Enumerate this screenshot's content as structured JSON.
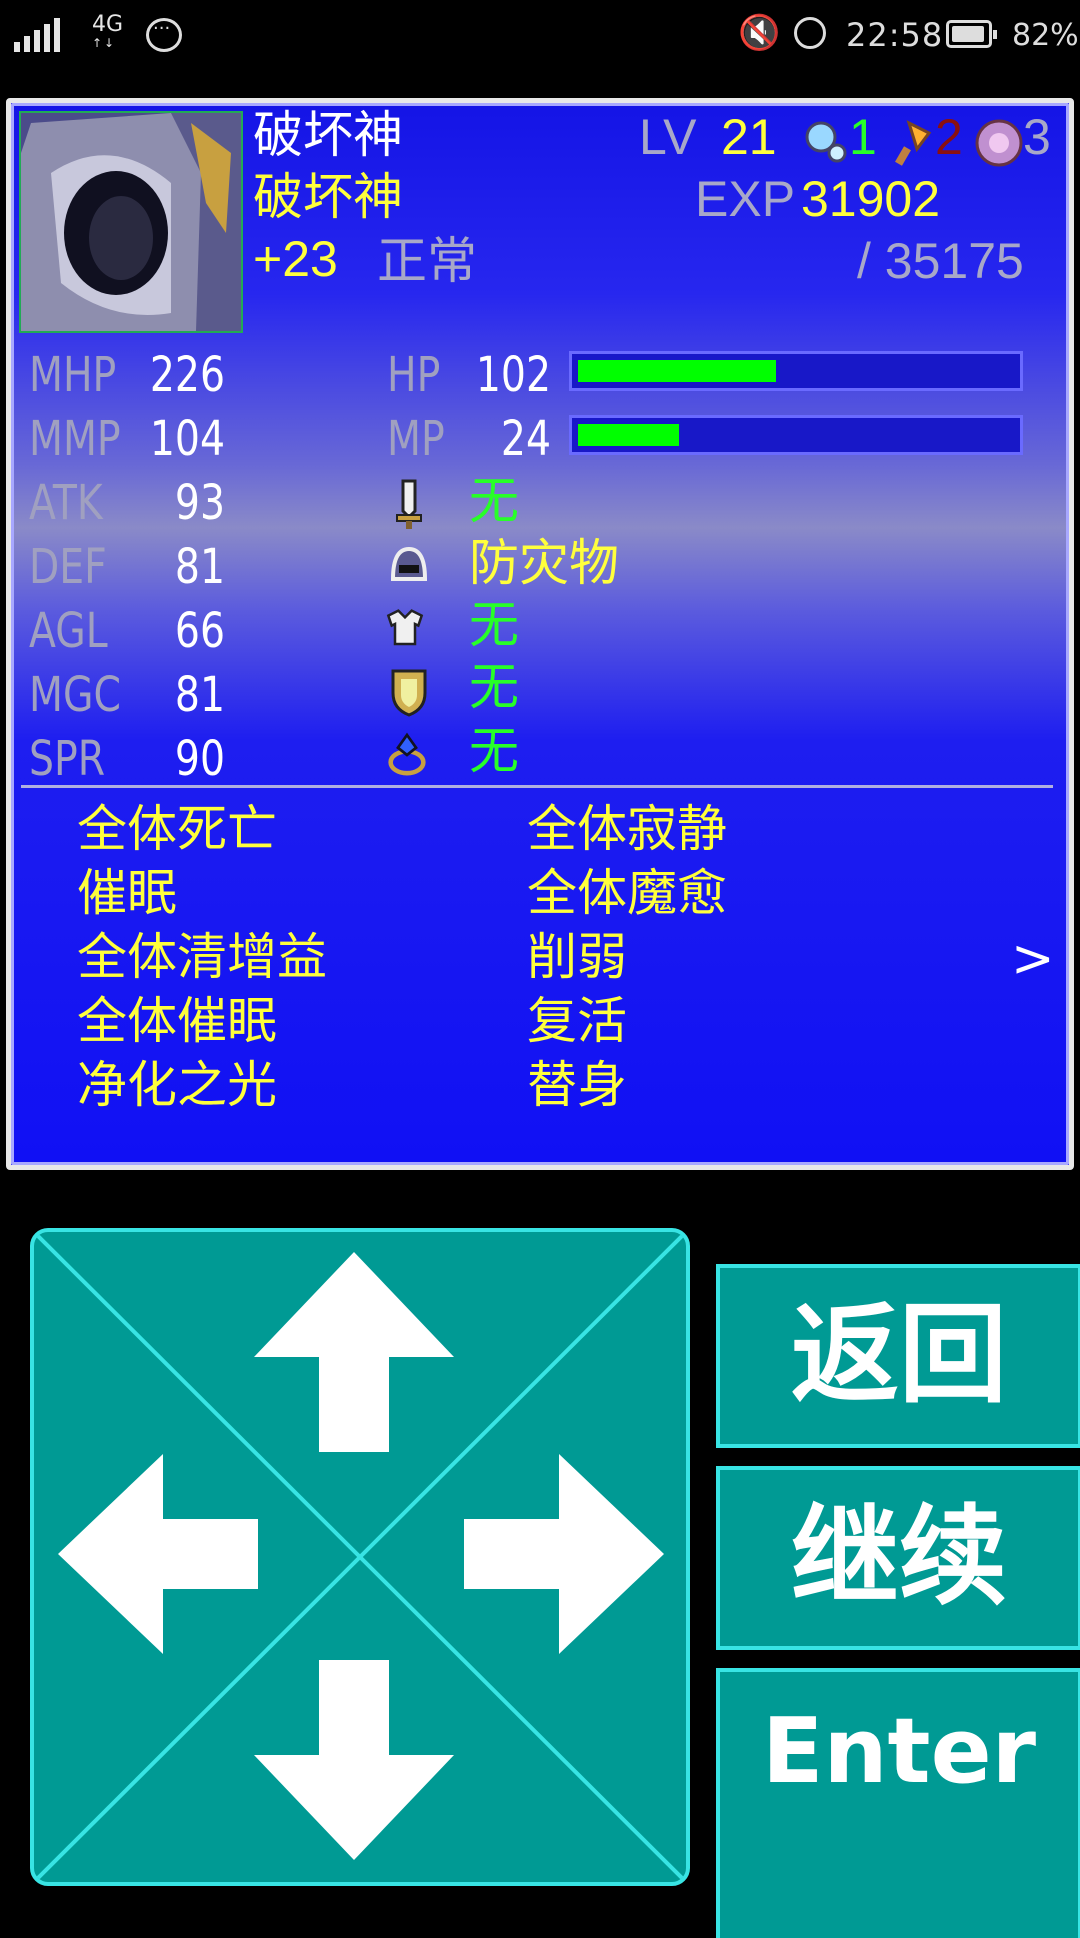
{
  "status_bar": {
    "network": "4G",
    "network_sub": "↑↓",
    "time": "22:58",
    "battery": "82%"
  },
  "character": {
    "name": "破坏神",
    "class": "破坏神",
    "plus": "+23",
    "condition": "正常",
    "lv_label": "LV",
    "level": "21",
    "exp_label": "EXP",
    "exp": "31902",
    "exp_next": "/ 35175",
    "items": [
      {
        "icon": "crystal-icon",
        "count": "1",
        "color": "#28ff28"
      },
      {
        "icon": "torch-icon",
        "count": "2",
        "color": "#8a1010"
      },
      {
        "icon": "orb-icon",
        "count": "3",
        "color": "#a8a8c8"
      }
    ]
  },
  "stats": [
    {
      "label": "MHP",
      "value": "226"
    },
    {
      "label": "MMP",
      "value": "104"
    },
    {
      "label": "ATK",
      "value": "93"
    },
    {
      "label": "DEF",
      "value": "81"
    },
    {
      "label": "AGL",
      "value": "66"
    },
    {
      "label": "MGC",
      "value": "81"
    },
    {
      "label": "SPR",
      "value": "90"
    }
  ],
  "gauges": {
    "hp_label": "HP",
    "hp": "102",
    "hp_ratio": 0.45,
    "mp_label": "MP",
    "mp": "24",
    "mp_ratio": 0.23
  },
  "equipment": [
    {
      "icon": "sword-icon",
      "name": "无"
    },
    {
      "icon": "helmet-icon",
      "name": "防灾物"
    },
    {
      "icon": "armor-icon",
      "name": "无"
    },
    {
      "icon": "shield-icon",
      "name": "无"
    },
    {
      "icon": "ring-icon",
      "name": "无"
    }
  ],
  "skills": [
    "全体死亡",
    "全体寂静",
    "催眠",
    "全体魔愈",
    "全体清增益",
    "削弱",
    "全体催眠",
    "复活",
    "净化之光",
    "替身"
  ],
  "controls": {
    "back": "返回",
    "continue": "继续",
    "enter": "Enter"
  },
  "colors": {
    "panel": "#009a94",
    "panel_border": "#38e4e4",
    "window_blue": "#1414e6",
    "gauge": "#00ff00",
    "text_yellow": "#ffff3c"
  }
}
